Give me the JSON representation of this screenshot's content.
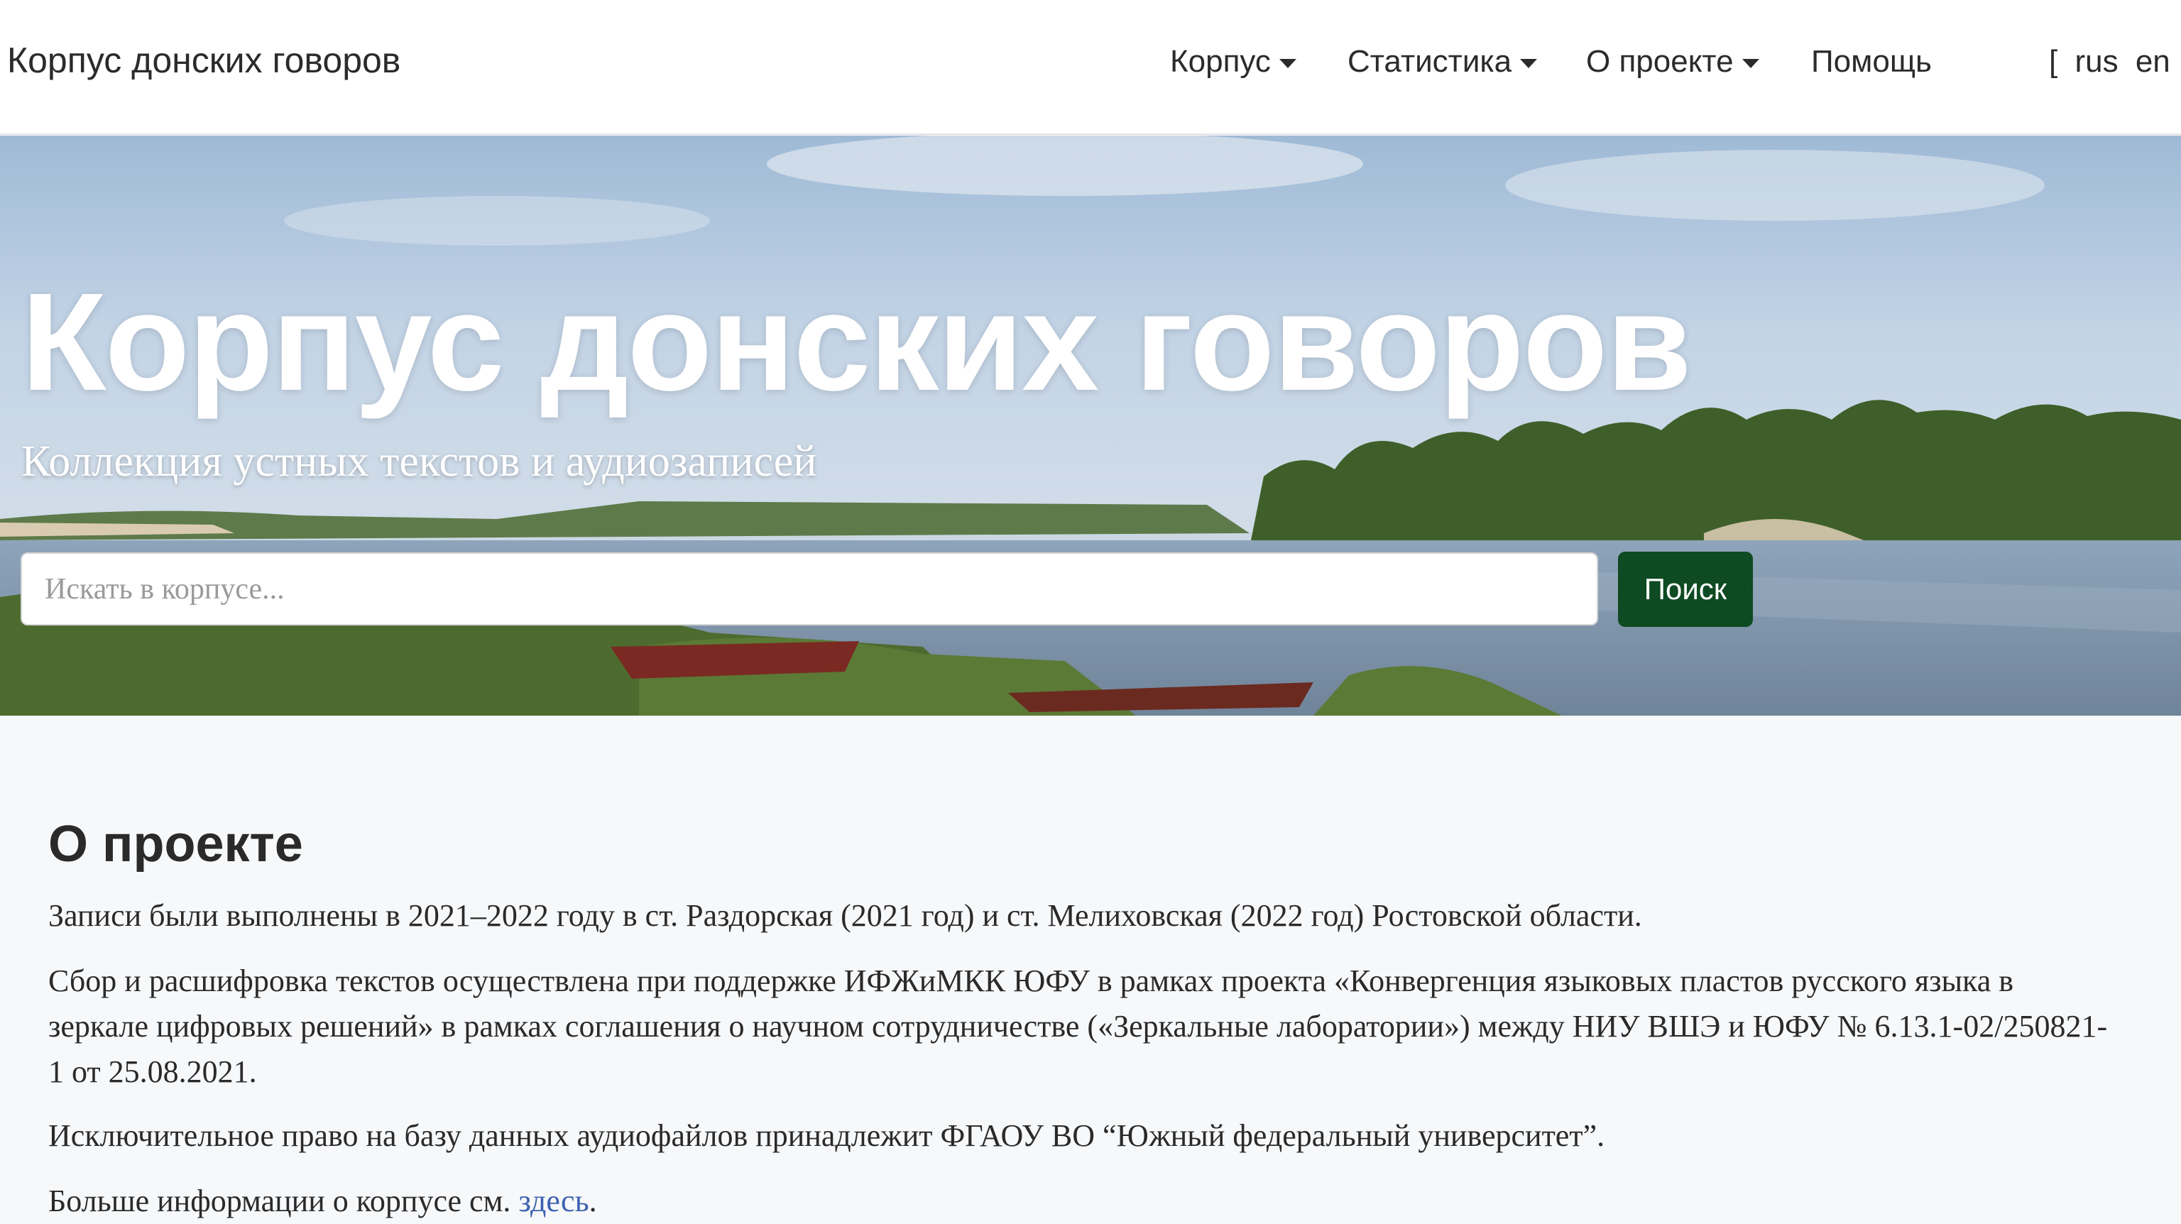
{
  "navbar": {
    "brand": "Корпус донских говоров",
    "items": [
      {
        "label": "Корпус"
      },
      {
        "label": "Статистика"
      },
      {
        "label": "О проекте"
      },
      {
        "label": "Помощь"
      }
    ],
    "lang": {
      "open": "[",
      "rus": "rus",
      "en": "en",
      "close": "]"
    }
  },
  "hero": {
    "title": "Корпус донских говоров",
    "subtitle": "Коллекция устных текстов и аудиозаписей",
    "search": {
      "placeholder": "Искать в корпусе...",
      "value": "",
      "button_label": "Поиск"
    }
  },
  "about": {
    "heading": "О проекте",
    "p1": "Записи были выполнены в 2021–2022 году в ст. Раздорская (2021 год) и ст. Мелиховская (2022 год) Ростовской области.",
    "p2": "Сбор и расшифровка текстов осуществлена при поддержке ИФЖиМКК ЮФУ в рамках проекта «Конвергенция языковых пластов русского языка в зеркале цифровых решений» в рамках соглашения о научном сотрудничестве («Зеркальные лаборатории») между НИУ ВШЭ и ЮФУ № 6.13.1-02/250821-1 от 25.08.2021.",
    "p3": "Исключительное право на базу данных аудиофайлов принадлежит ФГАОУ ВО “Южный федеральный университет”.",
    "p4_prefix": "Больше информации о корпусе см. ",
    "p4_link": "здесь",
    "p4_suffix": "."
  },
  "colors": {
    "accent_button": "#0e4a22",
    "link": "#3d63b0",
    "section_bg": "#f7f8fa"
  },
  "icons": [
    "caret-down-icon"
  ]
}
